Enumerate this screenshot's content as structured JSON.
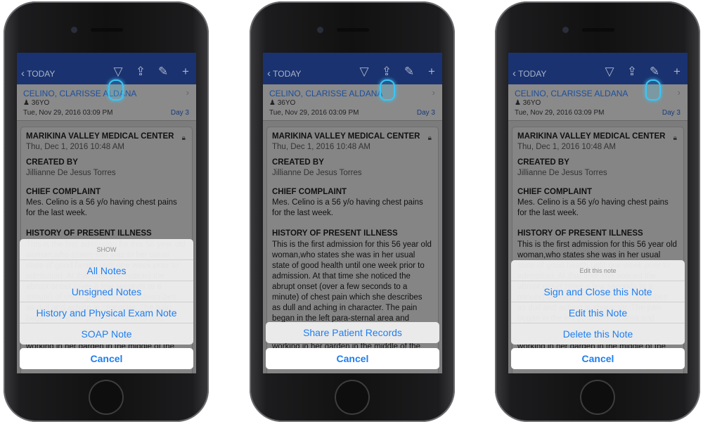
{
  "phones": [
    {
      "sheet": {
        "title": "SHOW",
        "items": [
          "All Notes",
          "Unsigned Notes",
          "History and Physical Exam Note",
          "SOAP Note"
        ]
      },
      "tapped": "filter-icon"
    },
    {
      "sheet": {
        "title": "",
        "items": [
          "Share Patient Records"
        ]
      },
      "tapped": "share-icon"
    },
    {
      "sheet": {
        "title": "Edit this note",
        "items": [
          "Sign and Close this Note",
          "Edit this Note",
          "Delete this Note"
        ]
      },
      "tapped": "compose-icon"
    }
  ],
  "nav": {
    "back": "TODAY",
    "icons": [
      "filter-icon",
      "share-icon",
      "compose-icon",
      "plus-icon"
    ]
  },
  "patient": {
    "name": "CELINO, CLARISSE ALDANA",
    "age": "36YO",
    "admitted": "Tue, Nov 29, 2016 03:09 PM",
    "day": "Day 3"
  },
  "note": {
    "facility": "MARIKINA VALLEY MEDICAL CENTER",
    "date": "Thu, Dec 1, 2016 10:48 AM",
    "created_by_label": "CREATED BY",
    "created_by": "Jillianne De Jesus Torres",
    "cc_label": "CHIEF COMPLAINT",
    "cc": [
      "Mes. Celino is a 56 y/o having chest pains",
      "for the last week."
    ],
    "hpi_label": "HISTORY OF PRESENT ILLNESS",
    "hpi": [
      "This is the first admission for this 56 year old",
      "woman,who states she was in her usual",
      "state of good health until one week prior to",
      "admission. At that time she noticed the",
      "abrupt onset (over a few seconds to a",
      "minute) of chest pain which she describes",
      "as dull and aching in character. The pain",
      "began in the left para-sternal area and"
    ],
    "hpi_lower": "working in her garden in the middle of the"
  },
  "cancel": "Cancel",
  "colors": {
    "nav": "#1a3270",
    "link": "#1e7ef0",
    "tap": "#3cc6f5"
  }
}
